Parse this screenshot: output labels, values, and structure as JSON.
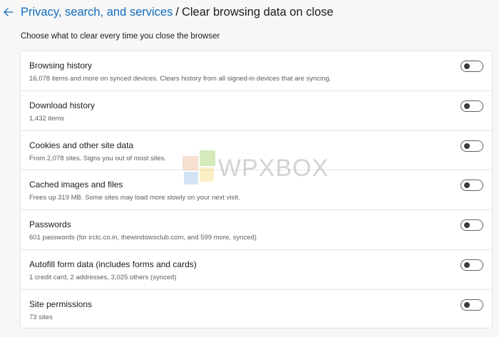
{
  "header": {
    "back_icon": "arrow-left-icon",
    "breadcrumb_parent": "Privacy, search, and services",
    "separator": "/",
    "current_page": "Clear browsing data on close"
  },
  "subtitle": "Choose what to clear every time you close the browser",
  "colors": {
    "accent": "#0f6cbd",
    "background": "#f7f7f7",
    "panel": "#ffffff"
  },
  "items": [
    {
      "title": "Browsing history",
      "description": "16,078 items and more on synced devices. Clears history from all signed-in devices that are syncing.",
      "toggle_on": false
    },
    {
      "title": "Download history",
      "description": "1,432 items",
      "toggle_on": false
    },
    {
      "title": "Cookies and other site data",
      "description": "From 2,078 sites. Signs you out of most sites.",
      "toggle_on": false
    },
    {
      "title": "Cached images and files",
      "description": "Frees up 319 MB. Some sites may load more slowly on your next visit.",
      "toggle_on": false
    },
    {
      "title": "Passwords",
      "description": "601 passwords (for irctc.co.in, thewindowsclub.com, and 599 more, synced)",
      "toggle_on": false
    },
    {
      "title": "Autofill form data (includes forms and cards)",
      "description": "1 credit card, 2 addresses, 3,025 others (synced)",
      "toggle_on": false
    },
    {
      "title": "Site permissions",
      "description": "73 sites",
      "toggle_on": false
    }
  ],
  "watermark": {
    "text": "WPXBOX"
  }
}
